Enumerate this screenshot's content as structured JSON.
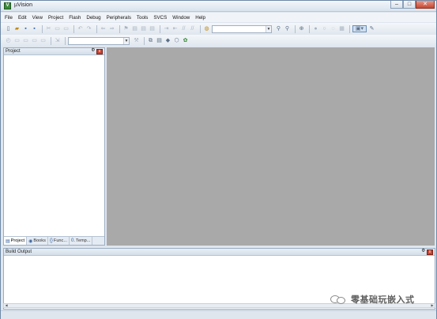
{
  "window": {
    "title": "µVision",
    "app_icon": "V",
    "controls": {
      "minimize": "–",
      "maximize": "□",
      "close": "✕"
    }
  },
  "menubar": {
    "items": [
      "File",
      "Edit",
      "View",
      "Project",
      "Flash",
      "Debug",
      "Peripherals",
      "Tools",
      "SVCS",
      "Window",
      "Help"
    ]
  },
  "toolbar1": {
    "target_combo_value": "",
    "icons": [
      "new-file-icon",
      "open-folder-icon",
      "save-icon",
      "save-all-icon",
      "cut-icon",
      "copy-icon",
      "paste-icon",
      "undo-icon",
      "redo-icon",
      "navigate-back-icon",
      "navigate-forward-icon",
      "bookmark-icon",
      "prev-bookmark-icon",
      "next-bookmark-icon",
      "clear-bookmarks-icon",
      "indent-icon",
      "unindent-icon",
      "comment-icon",
      "uncomment-icon",
      "find-in-files-icon",
      "find-icon",
      "incremental-find-icon",
      "debug-session-icon",
      "breakpoint-icon",
      "disable-breakpoint-icon",
      "kill-breakpoints-icon",
      "window-layout-icon",
      "configure-icon"
    ]
  },
  "toolbar2": {
    "target_combo_value": "",
    "icons": [
      "translate-icon",
      "build-icon",
      "rebuild-icon",
      "batch-build-icon",
      "stop-build-icon",
      "download-icon",
      "target-options-icon",
      "manage-components-icon",
      "select-packs-icon",
      "pack-installer-icon",
      "run-time-env-icon",
      "rte-check-icon"
    ]
  },
  "project_pane": {
    "title": "Project",
    "pin": "Ф",
    "close": "x",
    "tabs": [
      {
        "label": "Project",
        "icon": "project-icon",
        "glyph": "▤"
      },
      {
        "label": "Books",
        "icon": "books-icon",
        "glyph": "◉"
      },
      {
        "label": "Func...",
        "icon": "functions-icon",
        "glyph": "{}"
      },
      {
        "label": "Temp...",
        "icon": "templates-icon",
        "glyph": "0."
      }
    ]
  },
  "build_pane": {
    "title": "Build Output",
    "pin": "Ф",
    "close": "x"
  },
  "watermark": {
    "text": "零基础玩嵌入式"
  },
  "colors": {
    "editor_bg": "#a9a9a9",
    "chrome_bg": "#dfe6ee",
    "close_red": "#c9432f"
  }
}
